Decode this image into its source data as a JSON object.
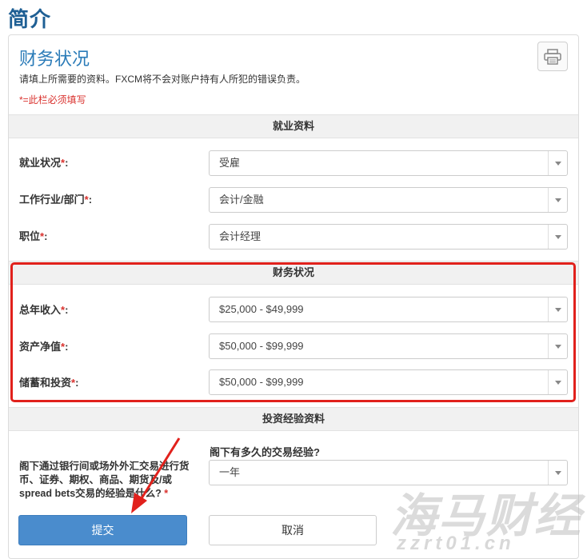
{
  "page_title": "简介",
  "section": {
    "title": "财务状况",
    "intro": "请填上所需要的资料。FXCM将不会对账户持有人所犯的错误负责。",
    "required_note": "*=此栏必须填写"
  },
  "icons": {
    "print": "printer-icon",
    "dropdown": "chevron-down-icon"
  },
  "colors": {
    "accent": "#2a7bb8",
    "required": "#d9302c",
    "highlight": "#e1211c",
    "submit": "#4a8ccd"
  },
  "employment": {
    "header": "就业资料",
    "fields": [
      {
        "label": "就业状况",
        "value": "受雇"
      },
      {
        "label": "工作行业/部门",
        "value": "会计/金融"
      },
      {
        "label": "职位",
        "value": "会计经理"
      }
    ]
  },
  "financial": {
    "header": "财务状况",
    "fields": [
      {
        "label": "总年收入",
        "value": "$25,000 - $49,999"
      },
      {
        "label": "资产净值",
        "value": "$50,000 - $99,999"
      },
      {
        "label": "储蓄和投资",
        "value": "$50,000 - $99,999"
      }
    ]
  },
  "experience": {
    "header": "投资经验资料",
    "question": "阁下有多久的交易经验?",
    "label": "阁下通过银行间或场外外汇交易进行货币、证券、期权、商品、期货及/或spread bets交易的经验是什么?",
    "value": "一年"
  },
  "buttons": {
    "submit": "提交",
    "cancel": "取消"
  },
  "required_marker": "*",
  "watermark": {
    "text": "海马财经",
    "url": "zzrt01.cn"
  }
}
